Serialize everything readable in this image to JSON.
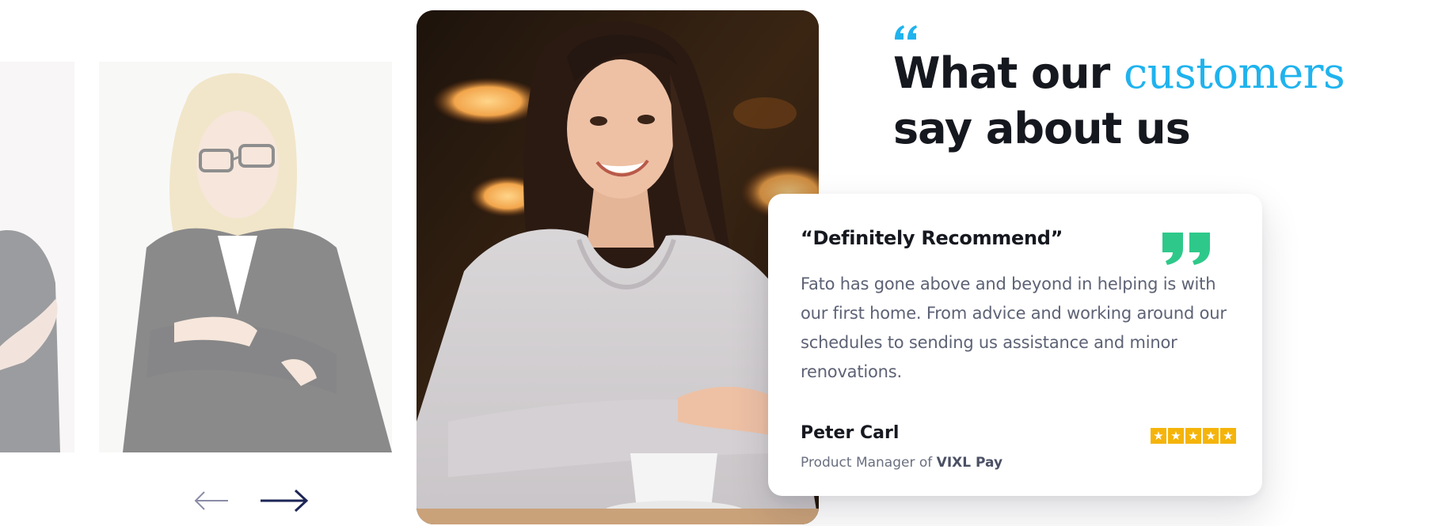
{
  "heading": {
    "line1_prefix": "What our ",
    "line1_accent": "customers",
    "line2": "say about us",
    "accent_color": "#1fb3ee",
    "quote_icon": "double-quote-open-icon"
  },
  "testimonial": {
    "title": "“Definitely Recommend”",
    "body": "Fato has gone above and beyond in helping is with our first home. From advice and working around our schedules to sending us assistance and minor renovations.",
    "author_name": "Peter Carl",
    "author_role_prefix": "Product Manager of ",
    "author_company": "VIXL Pay",
    "rating": 5,
    "rating_max": 5,
    "star_color": "#f5b40a",
    "quote_icon_color": "#2ec98a"
  },
  "carousel": {
    "prev_icon": "arrow-left-icon",
    "next_icon": "arrow-right-icon"
  }
}
